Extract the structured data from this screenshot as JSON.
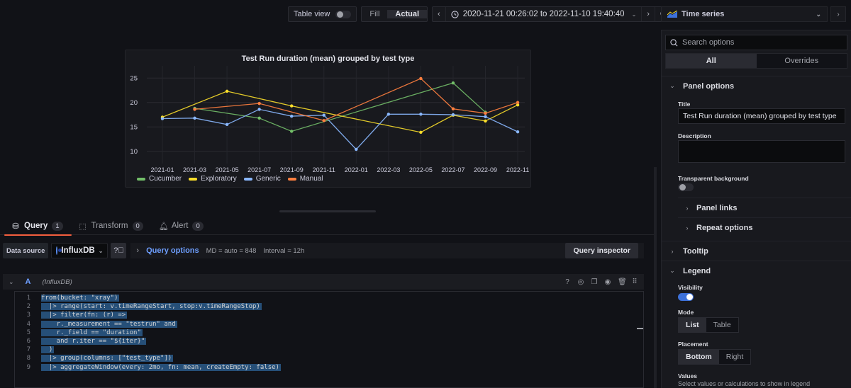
{
  "toolbar": {
    "table_view_label": "Table view",
    "table_view_on": false,
    "fill_label": "Fill",
    "actual_label": "Actual",
    "active_mode": "Actual",
    "time_range": "2020-11-21 00:26:02 to 2022-11-10 19:40:40"
  },
  "panel": {
    "title": "Test Run duration (mean) grouped by test type"
  },
  "chart_data": {
    "type": "line",
    "title": "Test Run duration (mean) grouped by test type",
    "xlabel": "",
    "ylabel": "",
    "categories": [
      "2021-01",
      "2021-03",
      "2021-05",
      "2021-07",
      "2021-09",
      "2021-11",
      "2022-01",
      "2022-03",
      "2022-05",
      "2022-07",
      "2022-09",
      "2022-11"
    ],
    "yticks": [
      10,
      15,
      20,
      25
    ],
    "ylim": [
      7.5,
      27.5
    ],
    "grid": true,
    "legend_position": "bottom-left",
    "series": [
      {
        "name": "Cucumber",
        "color": "#73bf69",
        "values": [
          null,
          18.8,
          null,
          16.8,
          14.1,
          null,
          null,
          null,
          null,
          24.0,
          18.0,
          null
        ]
      },
      {
        "name": "Exploratory",
        "color": "#fade2a",
        "values": [
          17.0,
          null,
          22.3,
          null,
          19.3,
          null,
          null,
          null,
          13.9,
          17.4,
          16.2,
          19.5
        ]
      },
      {
        "name": "Generic",
        "color": "#8ab8ff",
        "values": [
          16.7,
          16.8,
          15.5,
          18.6,
          17.2,
          17.4,
          10.4,
          17.6,
          17.6,
          17.5,
          17.1,
          14.0
        ]
      },
      {
        "name": "Manual",
        "color": "#ff7f3f",
        "values": [
          null,
          18.6,
          null,
          19.8,
          null,
          16.3,
          null,
          null,
          24.9,
          18.7,
          17.8,
          20.0
        ]
      }
    ]
  },
  "tabs": [
    {
      "label": "Query",
      "count": "1",
      "icon": "database-icon",
      "active": true
    },
    {
      "label": "Transform",
      "count": "0",
      "icon": "transform-icon",
      "active": false
    },
    {
      "label": "Alert",
      "count": "0",
      "icon": "bell-icon",
      "active": false
    }
  ],
  "query": {
    "data_source_label": "Data source",
    "data_source": "InfluxDB",
    "query_options_label": "Query options",
    "md": "MD = auto = 848",
    "interval": "Interval = 12h",
    "inspector_label": "Query inspector",
    "row_letter": "A",
    "row_ds": "(InfluxDB)",
    "lines": [
      "from(bucket: \"xray\")",
      "  |> range(start: v.timeRangeStart, stop:v.timeRangeStop)",
      "  |> filter(fn: (r) =>",
      "    r._measurement == \"testrun\" and",
      "    r._field == \"duration\"",
      "    and r.iter == \"${iter}\"",
      "  )",
      "  |> group(columns: [\"test_type\"])",
      "  |> aggregateWindow(every: 2mo, fn: mean, createEmpty: false)"
    ]
  },
  "sidebar": {
    "viz_name": "Time series",
    "search_placeholder": "Search options",
    "all_label": "All",
    "overrides_label": "Overrides",
    "panel_options_label": "Panel options",
    "title_label": "Title",
    "title_value": "Test Run duration (mean) grouped by test type",
    "description_label": "Description",
    "description_value": "",
    "transparent_label": "Transparent background",
    "transparent_on": false,
    "panel_links_label": "Panel links",
    "repeat_options_label": "Repeat options",
    "tooltip_label": "Tooltip",
    "legend_label": "Legend",
    "visibility_label": "Visibility",
    "visibility_on": true,
    "mode_label": "Mode",
    "mode_options": [
      "List",
      "Table"
    ],
    "mode_selected": "List",
    "placement_label": "Placement",
    "placement_options": [
      "Bottom",
      "Right"
    ],
    "placement_selected": "Bottom",
    "values_label": "Values",
    "values_desc": "Select values or calculations to show in legend"
  }
}
